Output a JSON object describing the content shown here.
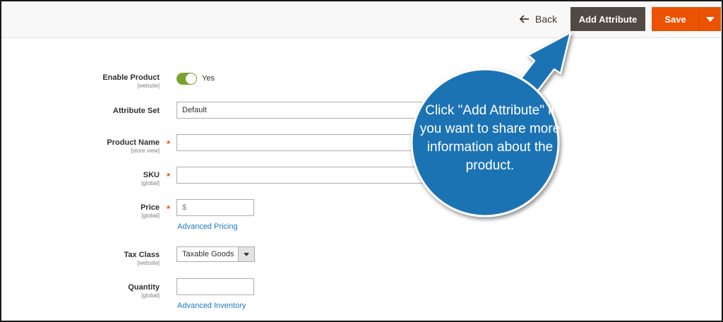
{
  "toolbar": {
    "back_label": "Back",
    "add_attribute_label": "Add Attribute",
    "save_label": "Save"
  },
  "form": {
    "enable_product": {
      "label": "Enable Product",
      "scope": "[website]",
      "value": "Yes",
      "enabled": true
    },
    "attribute_set": {
      "label": "Attribute Set",
      "value": "Default"
    },
    "product_name": {
      "label": "Product Name",
      "scope": "[store view]",
      "required": true,
      "value": ""
    },
    "sku": {
      "label": "SKU",
      "scope": "[global]",
      "required": true,
      "value": ""
    },
    "price": {
      "label": "Price",
      "scope": "[global]",
      "required": true,
      "currency": "$",
      "link": "Advanced Pricing"
    },
    "tax_class": {
      "label": "Tax Class",
      "scope": "[website]",
      "value": "Taxable Goods"
    },
    "quantity": {
      "label": "Quantity",
      "scope": "[global]",
      "value": "",
      "link": "Advanced Inventory"
    },
    "required_mark": "*"
  },
  "callout": {
    "text": "Click \"Add Attribute\" if you want to share more information about the product.",
    "color": "#1a73b4"
  },
  "colors": {
    "accent": "#eb5202",
    "dark_button": "#514943",
    "toggle_on": "#79a22e",
    "link": "#1979c3"
  }
}
